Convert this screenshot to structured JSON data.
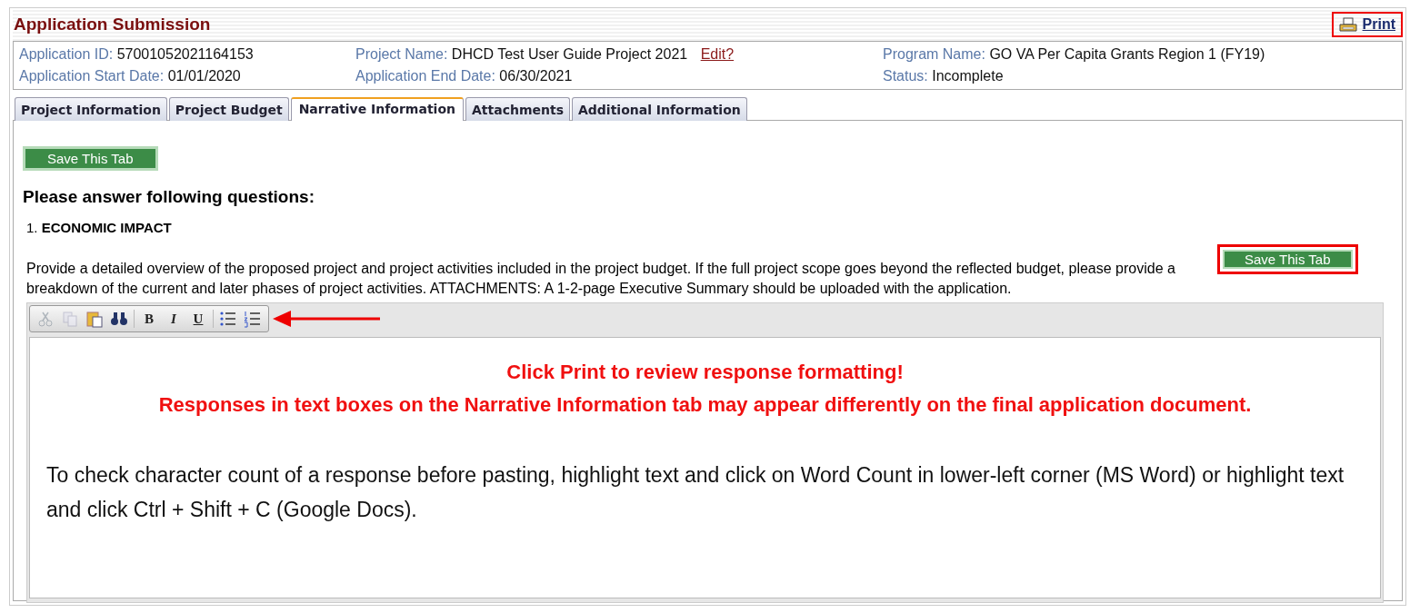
{
  "header": {
    "title": "Application Submission",
    "print": {
      "label": "Print",
      "highlighted": true
    }
  },
  "info": [
    {
      "label": "Application ID:",
      "value": "57001052021164153"
    },
    {
      "label": "Project Name:",
      "value": "DHCD Test User Guide Project 2021",
      "link": "Edit?"
    },
    {
      "label": "Program Name:",
      "value": "GO VA Per Capita Grants Region 1 (FY19)"
    },
    {
      "label": "Application Start Date:",
      "value": "01/01/2020"
    },
    {
      "label": "Application End Date:",
      "value": "06/30/2021"
    },
    {
      "label": "Status:",
      "value": "Incomplete"
    }
  ],
  "tabs": [
    {
      "label": "Project Information",
      "selected": false
    },
    {
      "label": "Project Budget",
      "selected": false
    },
    {
      "label": "Narrative Information",
      "selected": true
    },
    {
      "label": "Attachments",
      "selected": false
    },
    {
      "label": "Additional Information",
      "selected": false
    }
  ],
  "save_button": {
    "label": "Save This Tab",
    "highlighted": false
  },
  "heading": "Please answer following questions:",
  "question": {
    "number": "1.",
    "title": "ECONOMIC IMPACT",
    "save_button": {
      "label": "Save This Tab",
      "highlighted": true
    },
    "description": "Provide a detailed overview of the proposed project and project activities included in the project budget. If the full project scope goes beyond the reflected budget, please provide a breakdown of the current and later phases of project activities. ATTACHMENTS: A 1-2-page Executive Summary should be uploaded with the application."
  },
  "toolbar": [
    {
      "kind": "cut",
      "disabled": true
    },
    {
      "kind": "copy",
      "disabled": true
    },
    {
      "kind": "paste",
      "disabled": false
    },
    {
      "kind": "find",
      "disabled": false
    },
    {
      "kind": "sep"
    },
    {
      "kind": "bold",
      "text": "B",
      "disabled": false
    },
    {
      "kind": "italic",
      "text": "I",
      "disabled": false
    },
    {
      "kind": "underline",
      "text": "U",
      "disabled": false
    },
    {
      "kind": "sep"
    },
    {
      "kind": "bullets",
      "disabled": false
    },
    {
      "kind": "numbers",
      "disabled": false
    }
  ],
  "toolbar_arrow": true,
  "editor": {
    "warnings": [
      "Click Print to review response formatting!",
      "Responses in text boxes on the Narrative Information tab may appear differently on the final application document."
    ],
    "body": "To check character count of a response before pasting, highlight text and click on Word Count in lower-left corner (MS Word) or highlight text and click Ctrl + Shift + C (Google Docs)."
  }
}
